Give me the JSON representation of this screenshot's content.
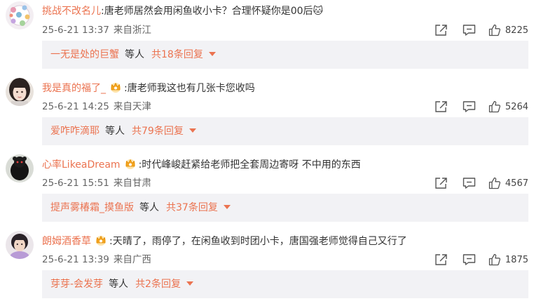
{
  "comments": [
    {
      "user": "挑战不改名儿",
      "text": ":唐老师居然会用闲鱼收小卡？合理怀疑你是00后",
      "emoji": "🐱",
      "date": "25-6-21 13:37",
      "source": "来自浙江",
      "likes": "8225",
      "reply": {
        "name": "一无是处的巨蟹",
        "middle": "等人",
        "count": "共18条回复"
      }
    },
    {
      "user": "我是真的福了_",
      "text": ":唐老师我这也有几张卡您收吗",
      "date": "25-6-21 14:25",
      "source": "来自天津",
      "likes": "5264",
      "reply": {
        "name": "爱咋咋滴耶",
        "middle": "等人",
        "count": "共79条回复"
      }
    },
    {
      "user": "心率LikeaDream",
      "text": ":时代峰峻赶紧给老师把全套周边寄呀  不中用的东西",
      "date": "25-6-21 15:51",
      "source": "来自甘肃",
      "likes": "4567",
      "reply": {
        "name": "提声雾椿霜_摸鱼版",
        "middle": "等人",
        "count": "共37条回复"
      }
    },
    {
      "user": "朗姆酒香草",
      "text": ":天晴了，雨停了，在闲鱼收到时团小卡，唐国强老师觉得自己又行了",
      "date": "25-6-21 13:39",
      "source": "来自广西",
      "likes": "1875",
      "reply": {
        "name": "芽芽-会发芽",
        "middle": "等人",
        "count": "共2条回复"
      }
    }
  ],
  "icons": {
    "share": "share-icon",
    "comment": "comment-icon",
    "like": "thumbs-up-icon",
    "badge": "fan-crown-badge-icon",
    "expand": "caret-down-icon"
  },
  "colors": {
    "username": "#eb7350",
    "reply_bg": "#f2f2f5",
    "meta": "#666666"
  }
}
